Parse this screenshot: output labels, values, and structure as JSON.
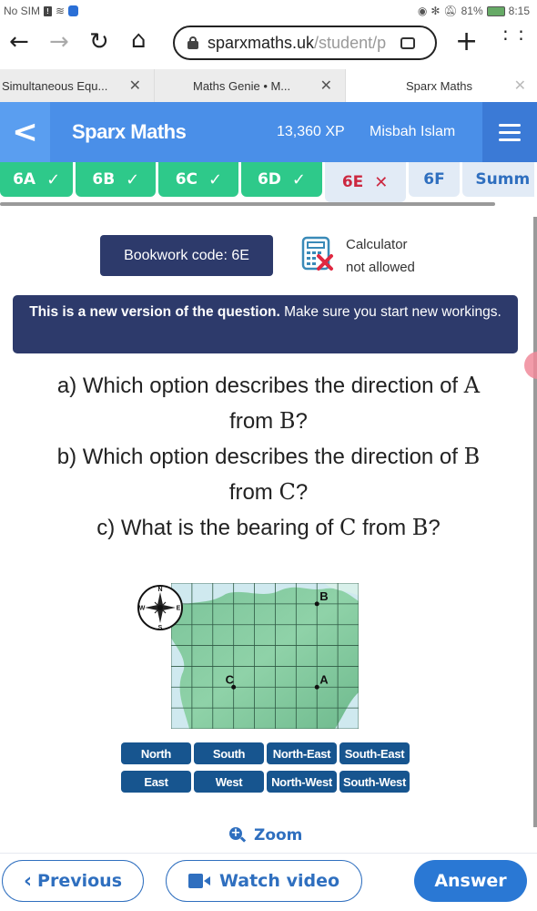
{
  "status_bar": {
    "carrier": "No SIM",
    "battery": "81%",
    "time": "8:15",
    "icons": [
      "sim-alert-icon",
      "wifi-icon",
      "hd-icon",
      "eye-icon",
      "bluetooth-icon",
      "mute-icon",
      "battery-icon"
    ]
  },
  "browser": {
    "url_host": "sparxmaths.uk",
    "url_path": "/student/p",
    "tabs": [
      {
        "label": "Simultaneous Equ...",
        "active": false
      },
      {
        "label": "Maths Genie • M...",
        "active": false
      },
      {
        "label": "Sparx Maths",
        "active": true
      }
    ]
  },
  "header": {
    "brand": "Sparx Maths",
    "xp": "13,360 XP",
    "user": "Misbah Islam"
  },
  "question_tabs": [
    {
      "label": "6A",
      "status": "correct",
      "mark": "✓"
    },
    {
      "label": "6B",
      "status": "correct",
      "mark": "✓"
    },
    {
      "label": "6C",
      "status": "correct",
      "mark": "✓"
    },
    {
      "label": "6D",
      "status": "correct",
      "mark": "✓"
    },
    {
      "label": "6E",
      "status": "incorrect",
      "mark": "✕"
    },
    {
      "label": "6F",
      "status": "todo",
      "mark": ""
    },
    {
      "label": "Summ",
      "status": "todo",
      "mark": ""
    }
  ],
  "bookwork": {
    "label": "Bookwork code: 6E"
  },
  "calculator": {
    "line1": "Calculator",
    "line2": "not allowed"
  },
  "notice": {
    "bold": "This is a new version of the question.",
    "rest": " Make sure you start new workings."
  },
  "question": {
    "parts": [
      {
        "prefix": "a) Which option describes the direction of ",
        "var1": "A",
        "mid": "from ",
        "var2": "B",
        "suffix": "?"
      },
      {
        "prefix": "b) Which option describes the direction of ",
        "var1": "B",
        "mid": "from ",
        "var2": "C",
        "suffix": "?"
      },
      {
        "prefix": "c) What is the bearing of ",
        "var1": "C",
        "mid": " from ",
        "var2": "B",
        "suffix": "?"
      }
    ]
  },
  "map": {
    "columns": 9,
    "rows": 7,
    "compass": {
      "n": "N",
      "e": "E",
      "s": "S",
      "w": "W"
    },
    "points": [
      {
        "label": "B",
        "col": 7,
        "row": 1
      },
      {
        "label": "C",
        "col": 3,
        "row": 5
      },
      {
        "label": "A",
        "col": 7,
        "row": 5
      }
    ]
  },
  "options": [
    "North",
    "South",
    "North-East",
    "South-East",
    "East",
    "West",
    "North-West",
    "South-West"
  ],
  "footer": {
    "zoom": "Zoom",
    "previous": "Previous",
    "watch_video": "Watch video",
    "answer": "Answer"
  },
  "colors": {
    "header_blue": "#4a8fe8",
    "tab_green": "#2ec98a",
    "wrong_red": "#cc2840",
    "navy": "#2d3a6b",
    "option_blue": "#17558f",
    "accent": "#2f6fbf"
  }
}
